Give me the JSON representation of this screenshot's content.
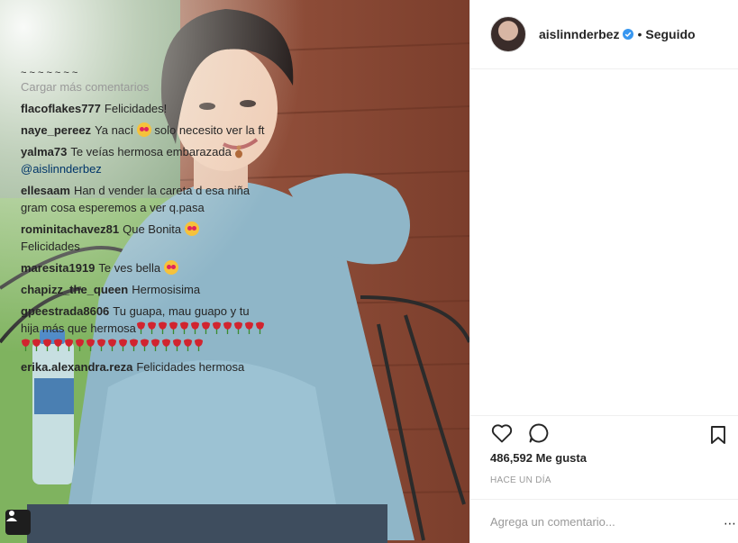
{
  "post": {
    "author": "aislinnderbez",
    "follow_status": "Seguido",
    "separator": "•",
    "load_more": "Cargar más comentarios",
    "likes": "486,592 Me gusta",
    "time": "HACE UN DÍA",
    "comment_placeholder": "Agrega un comentario..."
  },
  "comments": [
    {
      "user": "flacoflakes777",
      "text": "Felicidades!"
    },
    {
      "user": "naye_pereez",
      "text": "Ya nací",
      "emoji": "heart-eyes",
      "text_after": " solo necesito ver la ft"
    },
    {
      "user": "yalma73",
      "text": "Te veías hermosa embarazada",
      "emoji": "pregnant-woman",
      "mention": "@aislinnderbez"
    },
    {
      "user": "ellesaam",
      "text": "Han d vender la careta d esa niña gram cosa esperemos a ver q.pasa"
    },
    {
      "user": "rominitachavez81",
      "text": "Que Bonita",
      "emoji": "heart-eyes",
      "text_after": " Felicidades"
    },
    {
      "user": "maresita1919",
      "text": "Te ves bella",
      "emoji": "heart-eyes"
    },
    {
      "user": "chapizz_the_queen",
      "text": "Hermosisima"
    },
    {
      "user": "gpeestrada8606",
      "text": "Tu guapa, mau guapo y tu hija más que hermosa",
      "emoji": "rose",
      "emoji_count": 29
    },
    {
      "user": "erika.alexandra.reza",
      "text": "Felicidades hermosa"
    }
  ],
  "icons": {
    "verified": "verified-badge-icon",
    "like": "heart-outline-icon",
    "comment": "speech-bubble-icon",
    "save": "bookmark-icon",
    "tag": "person-tag-icon",
    "more": "more-options-icon"
  },
  "colors": {
    "verified": "#3897f0",
    "mention": "#003569",
    "muted": "#999999",
    "border": "#efefef"
  }
}
